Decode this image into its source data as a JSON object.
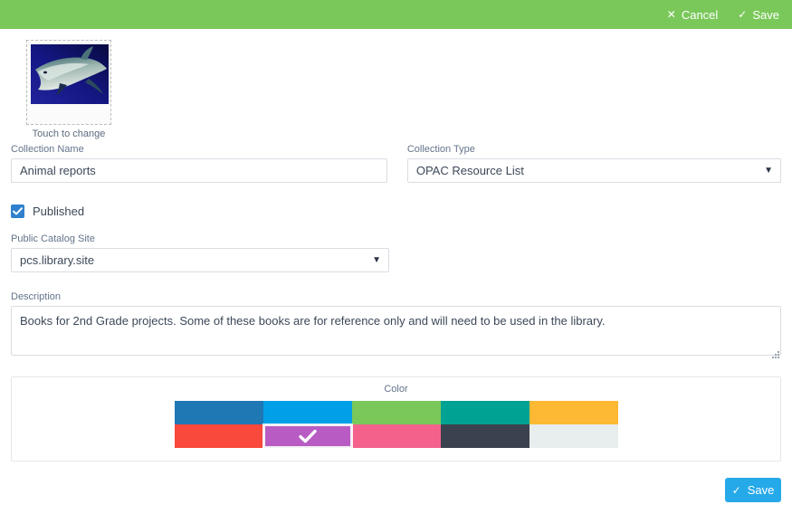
{
  "topbar": {
    "background": "#7ac85a",
    "cancel_label": "Cancel",
    "cancel_icon": "close-x-icon",
    "save_label": "Save",
    "save_icon": "check-icon"
  },
  "image_picker": {
    "caption": "Touch to change",
    "image_alt": "shark-photo",
    "border_style": "dashed"
  },
  "form": {
    "collection_name": {
      "label": "Collection Name",
      "value": "Animal reports",
      "placeholder": ""
    },
    "collection_type": {
      "label": "Collection Type",
      "value": "OPAC Resource List",
      "options": [
        "OPAC Resource List"
      ]
    },
    "published": {
      "label": "Published",
      "checked": true,
      "checkbox_color": "#2f80cd"
    },
    "public_catalog_site": {
      "label": "Public Catalog Site",
      "value": "pcs.library.site",
      "options": [
        "pcs.library.site"
      ]
    },
    "description": {
      "label": "Description",
      "value": "Books for 2nd Grade projects. Some of these books are for reference only and will need to be used in the library.",
      "placeholder": ""
    }
  },
  "color_panel": {
    "title": "Color",
    "selected_index": 6,
    "swatches": [
      {
        "name": "swatch-blue-dark",
        "hex": "#1f78b4"
      },
      {
        "name": "swatch-blue-light",
        "hex": "#00a0e9"
      },
      {
        "name": "swatch-green",
        "hex": "#7ac85a"
      },
      {
        "name": "swatch-teal",
        "hex": "#00a294"
      },
      {
        "name": "swatch-amber",
        "hex": "#fdb933"
      },
      {
        "name": "swatch-red",
        "hex": "#f9483c"
      },
      {
        "name": "swatch-purple",
        "hex": "#b85cc4"
      },
      {
        "name": "swatch-pink",
        "hex": "#f4628c"
      },
      {
        "name": "swatch-slate",
        "hex": "#3b424f"
      },
      {
        "name": "swatch-light-grey",
        "hex": "#e8eded"
      }
    ]
  },
  "footer": {
    "save_label": "Save",
    "save_icon": "check-icon",
    "save_color": "#26a9e8"
  }
}
